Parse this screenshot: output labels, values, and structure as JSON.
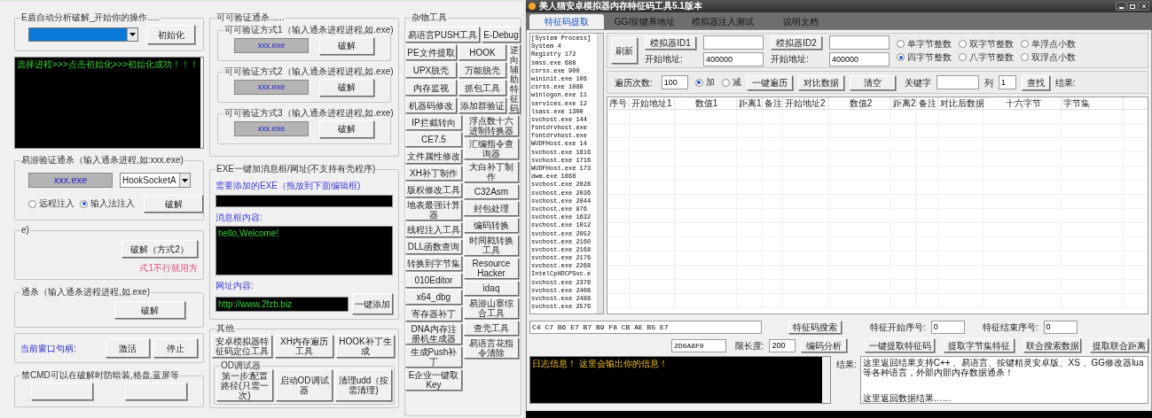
{
  "left_window": {
    "eshield": {
      "label": "E盾自动分析破解_开始你的操作.....",
      "button": "初始化"
    },
    "log": "选择进程>>>点击初始化>>>初始化成功！！！",
    "yiyou": {
      "label": "易游验证通杀（输入通杀进程,如:xxx.exe)",
      "field": "xxx.exe",
      "dropdown": "HookSocketA",
      "radios": [
        {
          "label": "远程注入",
          "selected": false
        },
        {
          "label": "输入法注入",
          "selected": true
        }
      ],
      "button": "破解"
    },
    "method2": {
      "label": "e)",
      "button": "破解（方式2）",
      "note": "式1不行就用方"
    },
    "tongsha": {
      "label": "通杀（输入通杀进程进程,如.exe)",
      "button": "破解"
    },
    "window_handle": {
      "label": "当前窗口句柄:",
      "buttons": [
        "激活",
        "停止"
      ]
    },
    "cmd": {
      "label": "禁CMD可以在破解时防暗装,格盘,蓝屏等"
    },
    "kk": {
      "label": "可可验证通杀......",
      "methods": [
        {
          "label": "可可验证方式1（输入通杀进程进程,如.exe)",
          "field": "xxx.exe",
          "button": "破解"
        },
        {
          "label": "可可验证方式2（输入通杀进程进程,如.exe)",
          "field": "xxx.exe",
          "button": "破解"
        },
        {
          "label": "可可验证方式3（输入通杀进程进程,如.exe)",
          "field": "xxx.exe",
          "button": "破解"
        }
      ]
    },
    "exe": {
      "label": "EXE一键加消息框/网址(不支持有壳程序)",
      "exe_label": "需要添加的EXE（拖放到下面编辑框)",
      "message_label": "消息框内容:",
      "message": "hello,Welcome!",
      "url_label": "网址内容:",
      "url": "http://www.2fzb.biz",
      "button": "一键添加"
    },
    "other": {
      "label": "其他",
      "buttons": [
        "安卓模拟器特征码定位工具",
        "XH内存遍历工具",
        "HOOK补丁生成"
      ],
      "od": {
        "label": "OD调试器",
        "buttons": [
          "第一步:配置路径(只需一次)",
          "启动OD调试器",
          "清理udd（按需清理)"
        ]
      }
    },
    "tools": {
      "label": "杂物工具",
      "top": [
        [
          "易语言PUSH工具",
          "E-Debug"
        ],
        [
          "PE文件提取",
          "HOOK"
        ],
        [
          "UPX脱壳",
          "万能脱壳"
        ],
        [
          "内存监视",
          "抓包工具"
        ],
        [
          "机器码修改",
          "添加群验证"
        ]
      ],
      "side": "逆向辅助特征码",
      "left": [
        "IP拦截转向",
        "CE7.5",
        "文件属性修改",
        "XH补丁制作",
        "版权修改工具",
        "地表最强计算器",
        "线程注入工具",
        "DLL函数查询",
        "转换到字节集",
        "010Editor",
        "x64_dbg",
        "寄存器补丁",
        "DNA内存注册机生成器",
        "生成Push补丁",
        "E企业一键取Key"
      ],
      "right": [
        "浮点数十六进制转换器",
        "汇编指令查询器",
        "大白补丁制作",
        "C32Asm",
        "封包处理",
        "编码转换",
        "时间戳转换工具",
        "Resource Hacker",
        "idaq",
        "易游山寨综合工具",
        "查壳工具",
        "易语言花指令清除"
      ]
    }
  },
  "app": {
    "title": "美人猫安卓模拟器内存特征码工具5.1版本",
    "tabs": [
      {
        "label": "特征码提取",
        "selected": true
      },
      {
        "label": "GG/按键基地址",
        "selected": false
      },
      {
        "label": "模拟器注入测试",
        "selected": false
      },
      {
        "label": "说明文档",
        "selected": false
      }
    ],
    "processes": [
      "[System Process]",
      "System 4",
      "Registry 172",
      "smss.exe 688",
      "csrss.exe 900",
      "wininit.exe 106",
      "csrss.exe 1088",
      "winlogon.exe 11",
      "services.exe 12",
      "lsass.exe 1300",
      "svchost.exe 144",
      "fontdrvhost.exe",
      "fontdrvhost.exe",
      "WUDFHost.exe 14",
      "svchost.exe 1616",
      "svchost.exe 1716",
      "WUDFHost.exe 173",
      "dwm.exe 1868",
      "svchost.exe 2028",
      "svchost.exe 2036",
      "svchost.exe 2044",
      "svchost.exe 876",
      "svchost.exe 1632",
      "svchost.exe 1012",
      "svchost.exe 2052",
      "svchost.exe 2160",
      "svchost.exe 2168",
      "svchost.exe 2176",
      "svchost.exe 2268",
      "IntelCpHDCPSvc.e",
      "svchost.exe 2376",
      "svchost.exe 2408",
      "svchost.exe 2488",
      "svchost.exe 2576"
    ],
    "refresh": "刷新",
    "emulators": [
      {
        "button": "模拟器ID1",
        "addr_label": "开始地址:",
        "addr": "400000"
      },
      {
        "button": "模拟器ID2",
        "addr_label": "开始地址:",
        "addr": "400000"
      }
    ],
    "types": [
      {
        "label": "单字节整数",
        "selected": false
      },
      {
        "label": "双字节整数",
        "selected": false
      },
      {
        "label": "单浮点小数",
        "selected": false
      },
      {
        "label": "四字节整数",
        "selected": true
      },
      {
        "label": "八字节整数",
        "selected": false
      },
      {
        "label": "双浮点小数",
        "selected": false
      }
    ],
    "traverse": {
      "label": "遍历次数:",
      "value": "100",
      "modes": [
        {
          "label": "加",
          "selected": true
        },
        {
          "label": "减",
          "selected": false
        }
      ],
      "buttons": [
        "一键遍历",
        "对比数据",
        "清空"
      ],
      "keyword_label": "关键字",
      "column_label": "列",
      "column": "1",
      "find": "查找",
      "result_label": "结果:"
    },
    "table": {
      "columns": [
        "序号",
        "开始地址1",
        "数值1",
        "距离1",
        "备注",
        "开始地址2",
        "数值2",
        "距离2",
        "备注",
        "对比后数据",
        "十六字节",
        "字节集"
      ]
    },
    "signature": {
      "hex": "C4 C7 B6 E7 B7 B9 F8 CB AE B5 E7",
      "search": "特征码搜索",
      "address": "2D0A8F0",
      "limit_label": "限长度:",
      "limit": "200",
      "analyze": "编码分析",
      "start_label": "特征开始序号:",
      "start": "0",
      "end_label": "特征结束序号:",
      "end": "0",
      "buttons": [
        "一键提取特征码",
        "提取字节集特征",
        "联合搜索数据",
        "提取联合距离"
      ]
    },
    "log": "日志信息！ 这里会输出你的信息！",
    "result_label": "结果:",
    "result_lines": [
      "这里返回结果支持C++ 、易语言、按键精灵安卓版、XS 、GG修改器lua等各种语言，外部内部内存数据通杀！",
      "这里返回数据结果……"
    ]
  }
}
